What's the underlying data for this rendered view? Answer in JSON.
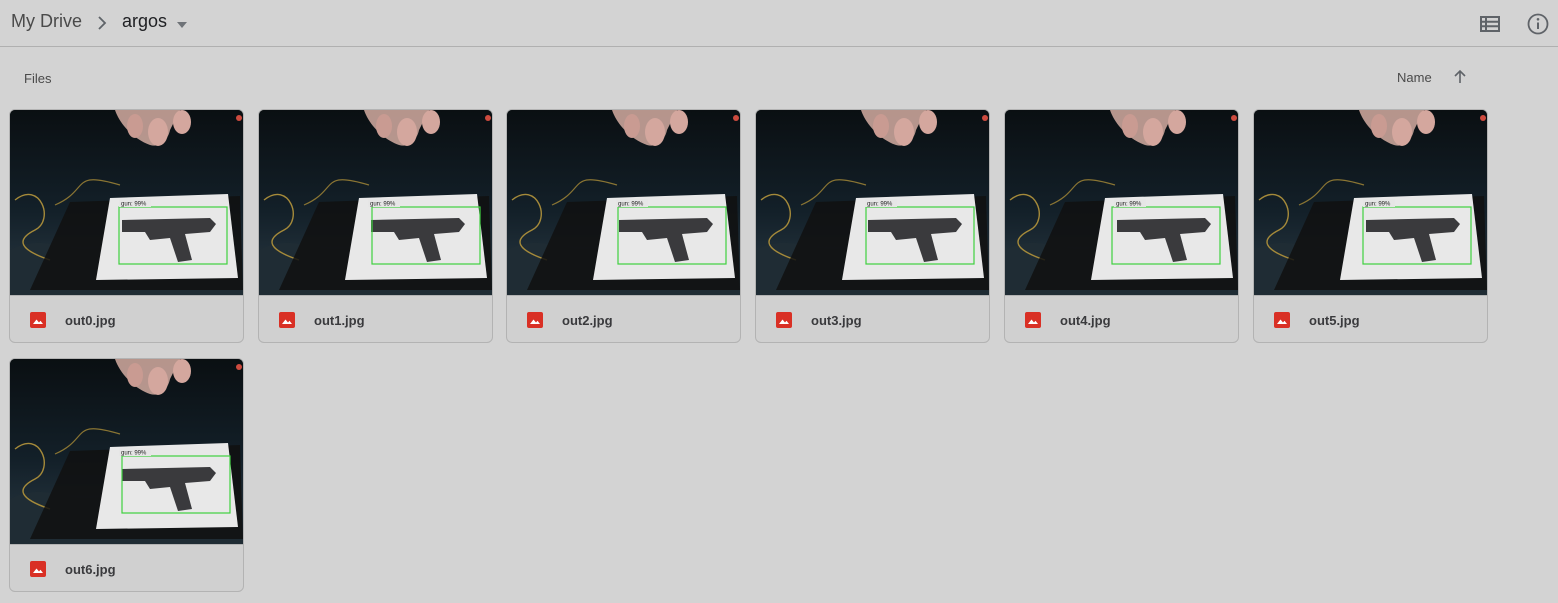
{
  "breadcrumb": {
    "root": "My Drive",
    "current": "argos"
  },
  "toolbar": {
    "list_view_icon": "list-view-icon",
    "info_icon": "info-icon"
  },
  "section": {
    "label": "Files",
    "sort_by": "Name",
    "sort_direction": "ascending"
  },
  "files": [
    {
      "name": "out0.jpg",
      "icon": "image-file-icon",
      "detection_label": "gun: 99%"
    },
    {
      "name": "out1.jpg",
      "icon": "image-file-icon",
      "detection_label": "gun: 99%"
    },
    {
      "name": "out2.jpg",
      "icon": "image-file-icon",
      "detection_label": "gun: 99%"
    },
    {
      "name": "out3.jpg",
      "icon": "image-file-icon",
      "detection_label": "gun: 99%"
    },
    {
      "name": "out4.jpg",
      "icon": "image-file-icon",
      "detection_label": "gun: 99%"
    },
    {
      "name": "out5.jpg",
      "icon": "image-file-icon",
      "detection_label": "gun: 99%"
    },
    {
      "name": "out6.jpg",
      "icon": "image-file-icon",
      "detection_label": "gun: 99%"
    }
  ],
  "colors": {
    "background": "#d3d3d3",
    "file_icon": "#d93025",
    "detection_box": "#3fd13f"
  }
}
